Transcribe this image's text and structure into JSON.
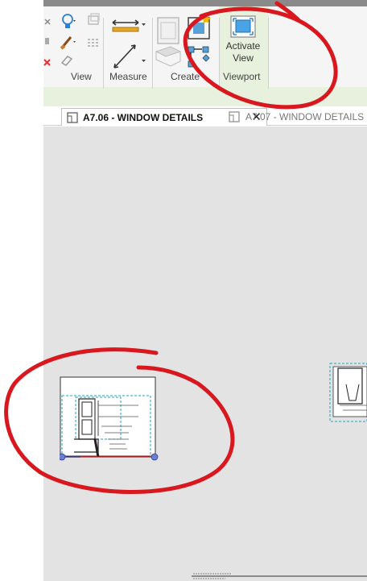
{
  "ribbon": {
    "panels": {
      "view_label": "View",
      "measure_label": "Measure",
      "create_label": "Create",
      "viewport_label": "Viewport"
    },
    "activate_view": {
      "line1": "Activate",
      "line2": "View"
    }
  },
  "tabs": [
    {
      "label": "A7.06 - WINDOW DETAILS",
      "active": true
    },
    {
      "label": "A7.07 - WINDOW DETAILS",
      "active": false
    }
  ],
  "colors": {
    "ribbon_bg": "#e8f1dd",
    "canvas_bg": "#e3e3e3",
    "annotation_red": "#d8181e",
    "viewport_dash": "#19a6c2",
    "grip_blue": "#6b7fd1"
  },
  "icons": [
    "light-bulb-icon",
    "paint-brush-icon",
    "eraser-icon",
    "measure-aligned-icon",
    "measure-diagonal-icon",
    "create-view-icon",
    "view-reference-icon",
    "activate-view-icon",
    "sheet-view-icon",
    "close-icon"
  ]
}
